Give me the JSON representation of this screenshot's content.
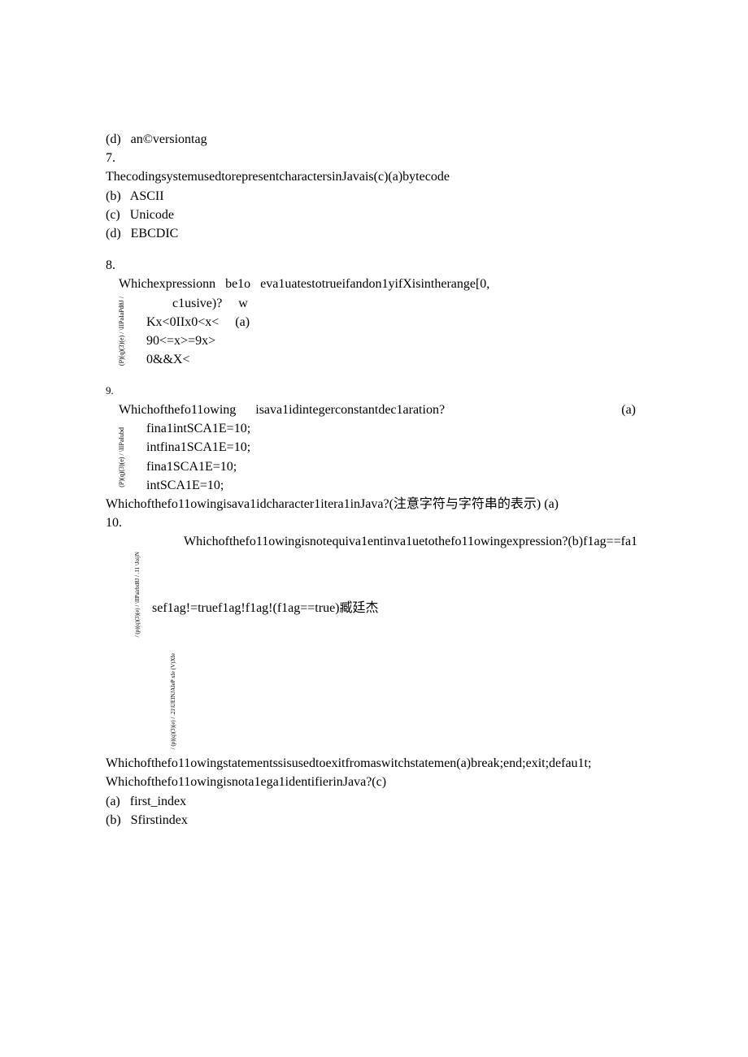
{
  "page": {
    "d_option": "(d)   an©versiontag",
    "q7_num": "7.",
    "q7_stem": "ThecodingsystemusedtorepresentcharactersinJavais(c)(a)bytecode",
    "q7_b": "(b)   ASCII",
    "q7_c": "(c)   Unicode",
    "q7_d": "(d)   EBCDIC",
    "q8_num": "8.",
    "q8_line1_left": "Whichexpressionn   be1o   eva1uatestotrueifandon1yifXisintherange[0,",
    "q8_line2_left": "c1usive)?     w",
    "q8_side": "(P)(q)(3)(e) / \\IIPaIaPd8J / ",
    "q8_l3": "Kx<0IIx0<x<     (a)",
    "q8_l4": "90<=x>=9x>",
    "q8_l5": "0&&X<",
    "q9_num": "9.",
    "q9_line1_left": "Whichofthefo11owing      isava1idintegerconstantdec1aration?",
    "q9_line1_right": "(a)",
    "q9_side": "(P)(q)(3)(e) / \\IIPaIubd ",
    "q9_l2": "fina1intSCA1E=10;",
    "q9_l3": "intfina1SCA1E=10;",
    "q9_l4": "fina1SCA1E=10;",
    "q9_l5": "intSCA1E=10;",
    "q_char": "Whichofthefo11owingisava1idcharacter1itera1inJava?(注意字符与字符串的表示) (a)",
    "q10_num": "10.",
    "q10_main": "Whichofthefo11owingisnotequiva1entinva1uetothefo11owingexpression?(b)f1ag==fa1",
    "q10_side1": " /  (p)(q)(3)(e) / \\IIPairbd8J / .11    \\JoijN ",
    "q10_l2": "sef1ag!=truef1ag!f1ag!(f1ag==true)臧廷杰",
    "q10_side2": " / (p)(q)(3)(e) / .21\\UEINJAIeP xIe (V)XIe ",
    "q_switch": "Whichofthefo11owingstatementssisusedtoexitfromaswitchstatemen(a)break;end;exit;defau1t;",
    "q_ident": "Whichofthefo11owingisnota1ega1identifierinJava?(c)",
    "q_ident_a": "(a)   first_index",
    "q_ident_b": "(b)   Sfirstindex"
  }
}
